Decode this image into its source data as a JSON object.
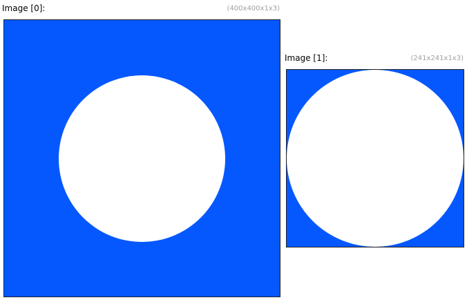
{
  "colors": {
    "image_background": "#0558fe",
    "circle_fill": "#ffffff",
    "dims_text": "#a0a0a0"
  },
  "images": [
    {
      "title": "Image  [0]:",
      "dims": "(400x400x1x3)"
    },
    {
      "title": "Image  [1]:",
      "dims": "(241x241x1x3)"
    }
  ]
}
